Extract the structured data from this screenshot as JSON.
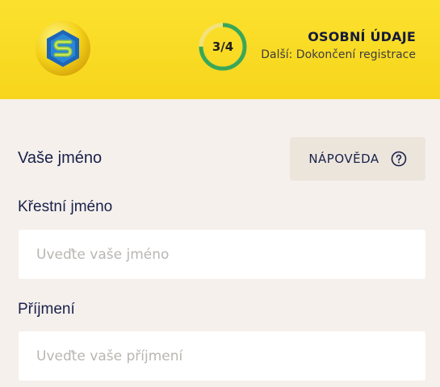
{
  "header": {
    "logo_icon": "brand-logo-icon",
    "progress": {
      "text": "3/4",
      "current": 3,
      "total": 4,
      "ring_color": "#3aa757",
      "track_color": "#f3e27a"
    },
    "step_title": "OSOBNÍ ÚDAJE",
    "next_step": "Další: Dokončení registrace",
    "background": "#f9dc27"
  },
  "section": {
    "title": "Vaše jméno",
    "help": {
      "label": "NÁPOVĚDA",
      "icon": "question-circle-icon"
    }
  },
  "form": {
    "first_name": {
      "label": "Křestní jméno",
      "value": "",
      "placeholder": "Uveďte vaše jméno"
    },
    "last_name": {
      "label": "Příjmení",
      "value": "",
      "placeholder": "Uveďte vaše příjmení"
    }
  }
}
